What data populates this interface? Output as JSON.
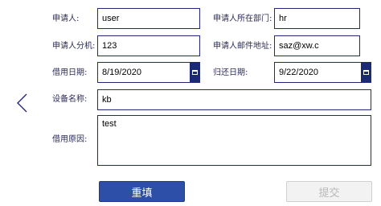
{
  "form": {
    "applicant_label": "申请人:",
    "applicant_value": "user",
    "department_label": "申请人所在部门:",
    "department_value": "hr",
    "extension_label": "申请人分机:",
    "extension_value": "123",
    "email_label": "申请人邮件地址:",
    "email_value": "saz@xw.c",
    "borrow_date_label": "借用日期:",
    "borrow_date_value": "8/19/2020",
    "return_date_label": "归还日期:",
    "return_date_value": "9/22/2020",
    "device_label": "设备名称:",
    "device_value": "kb",
    "reason_label": "借用原因:",
    "reason_value": "test"
  },
  "actions": {
    "reset_label": "重填",
    "submit_label": "提交"
  },
  "icons": {
    "back": "chevron-left-icon",
    "calendar": "calendar-icon"
  },
  "colors": {
    "accent": "#2d4fa8",
    "field_border": "#22287a",
    "calendar_button": "#1a2a75",
    "disabled_bg": "#f2f2f2",
    "disabled_text": "#b8b8b8"
  }
}
